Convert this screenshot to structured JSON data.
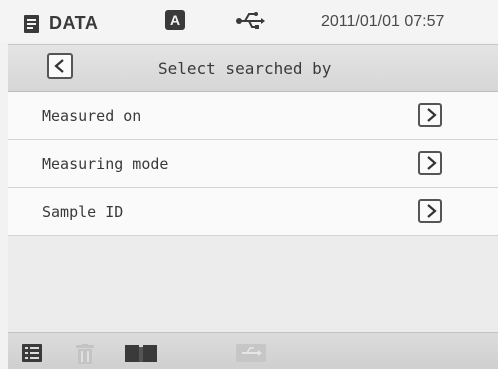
{
  "status_bar": {
    "mode_label": "DATA",
    "auto_icon_letter": "A",
    "datetime": "2011/01/01 07:57",
    "icons": [
      "document-icon",
      "auto-mode-icon",
      "usb-icon"
    ]
  },
  "header": {
    "title": "Select searched by",
    "back_icon": "chevron-left-icon"
  },
  "list": {
    "items": [
      {
        "label": "Measured on",
        "icon": "chevron-right-icon"
      },
      {
        "label": "Measuring mode",
        "icon": "chevron-right-icon"
      },
      {
        "label": "Sample ID",
        "icon": "chevron-right-icon"
      }
    ]
  },
  "toolbar": {
    "items": [
      {
        "icon": "list-icon",
        "enabled": true
      },
      {
        "icon": "trash-icon",
        "enabled": false
      },
      {
        "icon": "book-icon",
        "enabled": true
      },
      {
        "icon": "usb-transfer-icon",
        "enabled": false
      }
    ]
  },
  "colors": {
    "background": "#f2f2f2",
    "header": "#dadada",
    "text": "#3a3a3a",
    "disabled_icon": "#c4c4c4"
  }
}
